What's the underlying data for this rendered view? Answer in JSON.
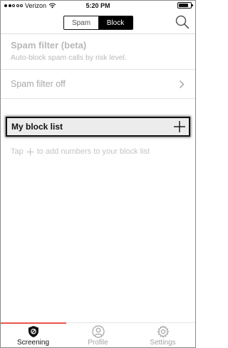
{
  "status_bar": {
    "carrier": "Verizon",
    "time": "5:20 PM",
    "signal_bars_filled": 2,
    "signal_bars_total": 5,
    "battery_level": 0.8
  },
  "segmented": {
    "spam_label": "Spam",
    "block_label": "Block",
    "selected": "Block"
  },
  "spam_filter": {
    "title": "Spam filter (beta)",
    "subtitle": "Auto-block spam calls by risk level.",
    "status_label": "Spam filter off"
  },
  "block_list": {
    "title": "My block list",
    "hint_prefix": "Tap",
    "hint_suffix": "to add numbers to your block list"
  },
  "tabs": [
    {
      "label": "Screening",
      "icon": "shield-block-icon",
      "active": true
    },
    {
      "label": "Profile",
      "icon": "profile-icon",
      "active": false
    },
    {
      "label": "Settings",
      "icon": "gear-icon",
      "active": false
    }
  ],
  "colors": {
    "accent": "#e8574a",
    "segment_active_bg": "#000000",
    "block_header_bg": "#ececec",
    "muted_text": "#b8b8b8"
  }
}
